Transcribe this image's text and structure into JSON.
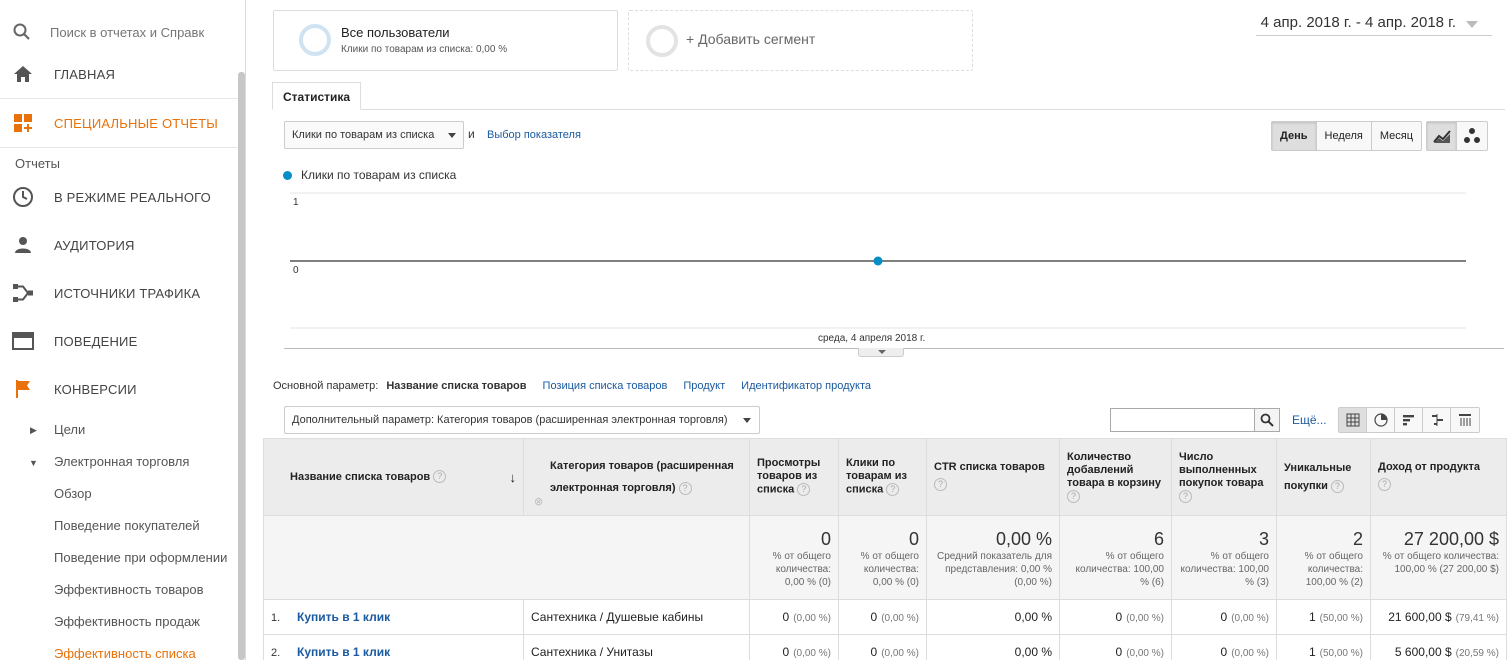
{
  "sidebar": {
    "search_placeholder": "Поиск в отчетах и Справк",
    "home": "ГЛАВНАЯ",
    "custom_reports": "СПЕЦИАЛЬНЫЕ ОТЧЕТЫ",
    "reports_label": "Отчеты",
    "realtime": "В РЕЖИМЕ РЕАЛЬНОГО",
    "audience": "АУДИТОРИЯ",
    "acquisition": "ИСТОЧНИКИ ТРАФИКА",
    "behavior": "ПОВЕДЕНИЕ",
    "conversions": "КОНВЕРСИИ",
    "goals": "Цели",
    "ecommerce": "Электронная торговля",
    "ecommerce_items": [
      "Обзор",
      "Поведение покупателей",
      "Поведение при оформлении",
      "Эффективность товаров",
      "Эффективность продаж",
      "Эффективность списка"
    ]
  },
  "segment": {
    "title": "Все пользователи",
    "subtitle": "Клики по товарам из списка: 0,00 %",
    "add": "+ Добавить сегмент"
  },
  "date_range": "4 апр. 2018 г. - 4 апр. 2018 г.",
  "tab": "Статистика",
  "explorer": {
    "metric": "Клики по товарам из списка",
    "and": "и",
    "choose_metric": "Выбор показателя",
    "periods": [
      "День",
      "Неделя",
      "Месяц"
    ],
    "selected_period": "День"
  },
  "chart_data": {
    "type": "line",
    "series": [
      {
        "name": "Клики по товарам из списка",
        "values": [
          0
        ]
      }
    ],
    "x": [
      "среда, 4 апреля 2018 г."
    ],
    "yticks": [
      "1",
      "0"
    ],
    "ylim": [
      0,
      1
    ],
    "x_label": "среда, 4 апреля 2018 г.",
    "color": "#058dc7"
  },
  "dimensions": {
    "label": "Основной параметр:",
    "current": "Название списка товаров",
    "links": [
      "Позиция списка товаров",
      "Продукт",
      "Идентификатор продукта"
    ],
    "secondary": "Дополнительный параметр: Категория товаров (расширенная электронная торговля)",
    "more": "Ещё..."
  },
  "table": {
    "headers": [
      "Название списка товаров",
      "Категория товаров (расширенная электронная торговля)",
      "Просмотры товаров из списка",
      "Клики по товарам из списка",
      "CTR списка товаров",
      "Количество добавлений товара в корзину",
      "Число выполненных покупок товара",
      "Уникальные покупки",
      "Доход от продукта"
    ],
    "totals": [
      {
        "value": "0",
        "note": "% от общего количества: 0,00 % (0)"
      },
      {
        "value": "0",
        "note": "% от общего количества: 0,00 % (0)"
      },
      {
        "value": "0,00 %",
        "note": "Средний показатель для представления: 0,00 % (0,00 %)"
      },
      {
        "value": "6",
        "note": "% от общего количества: 100,00 % (6)"
      },
      {
        "value": "3",
        "note": "% от общего количества: 100,00 % (3)"
      },
      {
        "value": "2",
        "note": "% от общего количества: 100,00 % (2)"
      },
      {
        "value": "27 200,00 $",
        "note": "% от общего количества: 100,00 % (27 200,00 $)"
      }
    ],
    "rows": [
      {
        "idx": "1.",
        "name": "Купить в 1 клик",
        "category": "Сантехника / Душевые кабины",
        "views": "0",
        "views_pct": "(0,00 %)",
        "clicks": "0",
        "clicks_pct": "(0,00 %)",
        "ctr": "0,00 %",
        "adds": "0",
        "adds_pct": "(0,00 %)",
        "purch": "0",
        "purch_pct": "(0,00 %)",
        "uniq": "1",
        "uniq_pct": "(50,00 %)",
        "rev": "21 600,00 $",
        "rev_pct": "(79,41 %)"
      },
      {
        "idx": "2.",
        "name": "Купить в 1 клик",
        "category": "Сантехника / Унитазы",
        "views": "0",
        "views_pct": "(0,00 %)",
        "clicks": "0",
        "clicks_pct": "(0,00 %)",
        "ctr": "0,00 %",
        "adds": "0",
        "adds_pct": "(0,00 %)",
        "purch": "0",
        "purch_pct": "(0,00 %)",
        "uniq": "1",
        "uniq_pct": "(50,00 %)",
        "rev": "5 600,00 $",
        "rev_pct": "(20,59 %)"
      }
    ]
  },
  "colors": {
    "accent_orange": "#e8710a",
    "link_blue": "#1a5aa0",
    "series_blue": "#058dc7"
  }
}
